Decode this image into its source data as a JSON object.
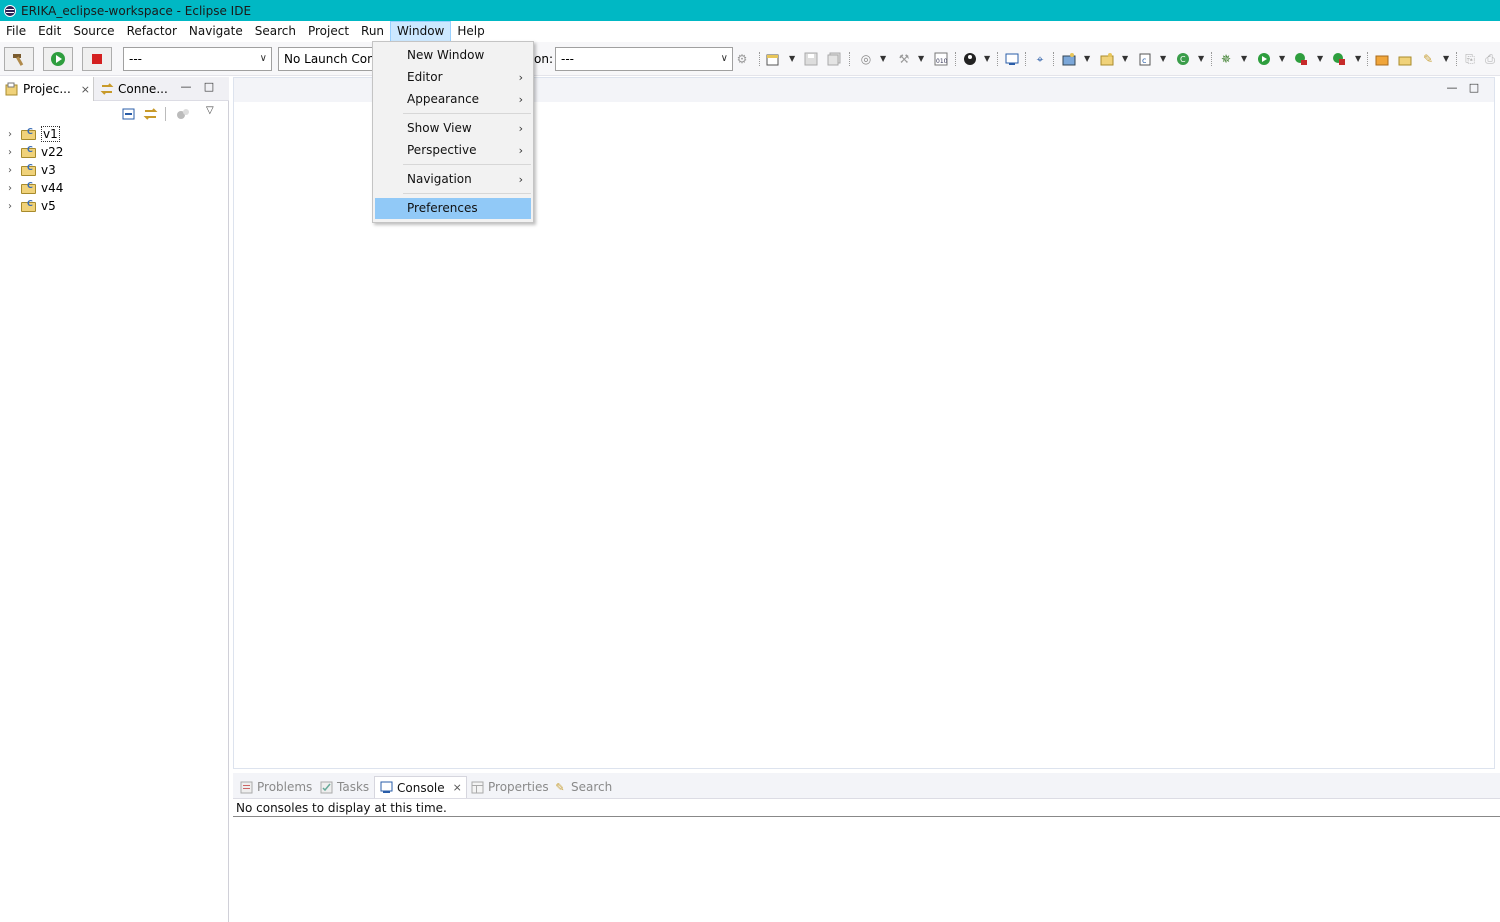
{
  "window": {
    "title": "ERIKA_eclipse-workspace - Eclipse IDE"
  },
  "menubar": {
    "items": [
      "File",
      "Edit",
      "Source",
      "Refactor",
      "Navigate",
      "Search",
      "Project",
      "Run",
      "Window",
      "Help"
    ],
    "active": "Window"
  },
  "toolbar": {
    "launch_mode": "---",
    "launch_config": "No Launch Conf",
    "on_label": "on:",
    "launch_target": "---"
  },
  "left_panel": {
    "tabs": [
      {
        "label": "Projec..."
      },
      {
        "label": "Conne..."
      }
    ],
    "projects": [
      "v1",
      "v22",
      "v3",
      "v44",
      "v5"
    ]
  },
  "bottom_panel": {
    "tabs": [
      "Problems",
      "Tasks",
      "Console",
      "Properties",
      "Search"
    ],
    "selected": "Console",
    "message": "No consoles to display at this time."
  },
  "window_menu": {
    "items": [
      {
        "label": "New Window",
        "submenu": false
      },
      {
        "label": "Editor",
        "submenu": true
      },
      {
        "label": "Appearance",
        "submenu": true
      },
      {
        "label": "Show View",
        "submenu": true
      },
      {
        "label": "Perspective",
        "submenu": true
      },
      {
        "label": "Navigation",
        "submenu": true
      },
      {
        "label": "Preferences",
        "submenu": false
      }
    ],
    "highlighted": "Preferences"
  },
  "colors": {
    "titlebar": "#00b8c4",
    "menu_highlight": "#91c9f7",
    "menubar_active": "#cce8ff"
  }
}
